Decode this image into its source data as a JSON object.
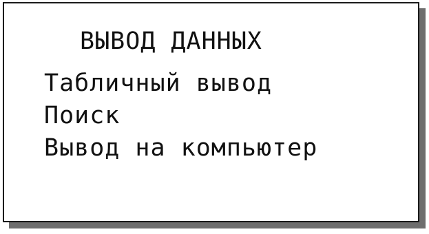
{
  "screen": {
    "title": "ВЫВОД ДАННЫХ",
    "menu_items": [
      {
        "label": "Табличный вывод"
      },
      {
        "label": "Поиск"
      },
      {
        "label": "Вывод на компьютер"
      }
    ]
  },
  "colors": {
    "text": "#111111",
    "background": "#ffffff",
    "border": "#1a1a1a",
    "shadow": "#6e6e6e"
  }
}
